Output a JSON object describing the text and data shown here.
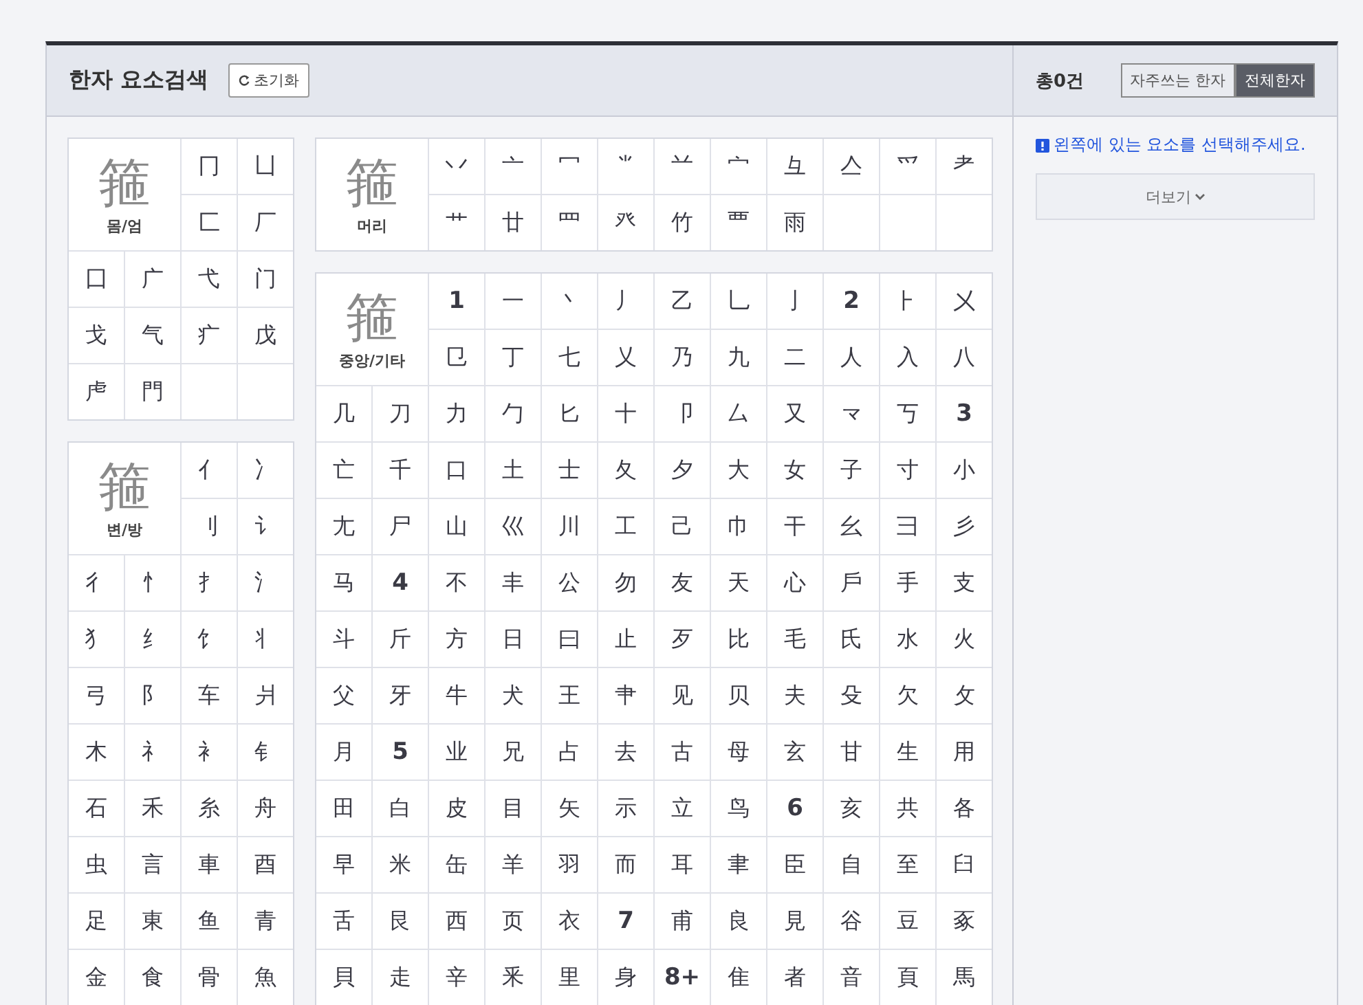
{
  "header": {
    "title": "한자 요소검색",
    "reset_button": "초기화"
  },
  "columns": [
    [
      {
        "label": "몸/엄",
        "glyph": "箍",
        "items": [
          "冂",
          "凵",
          "匚",
          "厂",
          "囗",
          "广",
          "弋",
          "门",
          "戈",
          "气",
          "疒",
          "戊",
          "虍",
          "門"
        ]
      },
      {
        "label": "변/방",
        "glyph": "箍",
        "items": [
          "亻",
          "冫",
          "刂",
          "讠",
          "彳",
          "忄",
          "扌",
          "氵",
          "犭",
          "纟",
          "饣",
          "丬",
          "弓",
          "阝",
          "车",
          "爿",
          "木",
          "礻",
          "衤",
          "钅",
          "石",
          "禾",
          "糸",
          "舟",
          "虫",
          "言",
          "車",
          "酉",
          "足",
          "東",
          "鱼",
          "青",
          "金",
          "食",
          "骨",
          "魚"
        ]
      }
    ],
    [
      {
        "label": "머리",
        "glyph": "箍",
        "items": [
          "丷",
          "亠",
          "冖",
          "⺌",
          "䒑",
          "宀",
          "彑",
          "亼",
          "爫",
          "耂",
          "艹",
          "廿",
          "罒",
          "癶",
          "竹",
          "覀",
          "雨"
        ]
      },
      {
        "label": "중앙/기타",
        "glyph": "箍",
        "items": [
          {
            "text": "1",
            "kind": "count"
          },
          "一",
          "丶",
          "丿",
          "乙",
          "乚",
          "亅",
          {
            "text": "2",
            "kind": "count"
          },
          "⺊",
          "㐅",
          "㔾",
          "丁",
          "七",
          "乂",
          "乃",
          "九",
          "二",
          "人",
          "入",
          "八",
          "几",
          "刀",
          "力",
          "勹",
          "匕",
          "十",
          "卩",
          "厶",
          "又",
          "龴",
          "丂",
          {
            "text": "3",
            "kind": "count"
          },
          "亡",
          "千",
          "口",
          "土",
          "士",
          "夂",
          "夕",
          "大",
          "女",
          "子",
          "寸",
          "小",
          "尢",
          "尸",
          "山",
          "巛",
          "川",
          "工",
          "己",
          "巾",
          "干",
          "幺",
          "彐",
          "彡",
          "马",
          {
            "text": "4",
            "kind": "count"
          },
          "不",
          "丰",
          "公",
          "勿",
          "友",
          "天",
          "心",
          "戶",
          "手",
          "支",
          "斗",
          "斤",
          "方",
          "日",
          "曰",
          "止",
          "歹",
          "比",
          "毛",
          "氏",
          "水",
          "火",
          "父",
          "牙",
          "牛",
          "犬",
          "王",
          "肀",
          "见",
          "贝",
          "夫",
          "殳",
          "欠",
          "攵",
          "月",
          {
            "text": "5",
            "kind": "count"
          },
          "业",
          "兄",
          "占",
          "去",
          "古",
          "母",
          "玄",
          "甘",
          "生",
          "用",
          "田",
          "白",
          "皮",
          "目",
          "矢",
          "示",
          "立",
          "鸟",
          {
            "text": "6",
            "kind": "count"
          },
          "亥",
          "共",
          "各",
          "早",
          "米",
          "缶",
          "羊",
          "羽",
          "而",
          "耳",
          "聿",
          "臣",
          "自",
          "至",
          "臼",
          "舌",
          "艮",
          "西",
          "页",
          "衣",
          {
            "text": "7",
            "kind": "count"
          },
          "甫",
          "良",
          "見",
          "谷",
          "豆",
          "豖",
          "貝",
          "走",
          "辛",
          "釆",
          "里",
          "身",
          {
            "text": "8+",
            "kind": "count"
          },
          "隹",
          "者",
          "音",
          "頁",
          "馬"
        ]
      }
    ]
  ],
  "results": {
    "total": "총0건",
    "filters": [
      {
        "label": "자주쓰는 한자",
        "selected": false
      },
      {
        "label": "전체한자",
        "selected": true
      }
    ],
    "notice": "왼쪽에 있는 요소를 선택해주세요.",
    "more_button": "더보기"
  }
}
